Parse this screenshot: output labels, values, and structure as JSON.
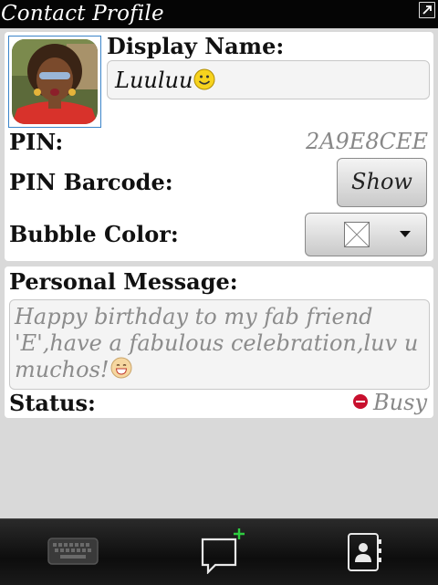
{
  "header": {
    "title": "Contact Profile",
    "expand_icon": "expand-icon"
  },
  "profile": {
    "avatar_icon": "contact-photo",
    "display_name_label": "Display Name:",
    "display_name_value": "Luuluu",
    "display_name_emoji": "smiley-icon",
    "pin_label": "PIN:",
    "pin_value": "2A9E8CEE",
    "pin_barcode_label": "PIN Barcode:",
    "show_button_label": "Show",
    "bubble_color_label": "Bubble Color:",
    "bubble_color_icon": "color-swatch-icon"
  },
  "message": {
    "label": "Personal Message:",
    "text": "Happy birthday to my fab friend 'E',have a fabulous celebration,luv u muchos!",
    "emoji": "grin-icon",
    "status_label": "Status:",
    "status_value": "Busy",
    "status_color": "#c8102e"
  },
  "toolbar": {
    "items": [
      "keyboard-icon",
      "new-chat-icon",
      "contacts-icon"
    ],
    "accent": "#2ecc40"
  }
}
